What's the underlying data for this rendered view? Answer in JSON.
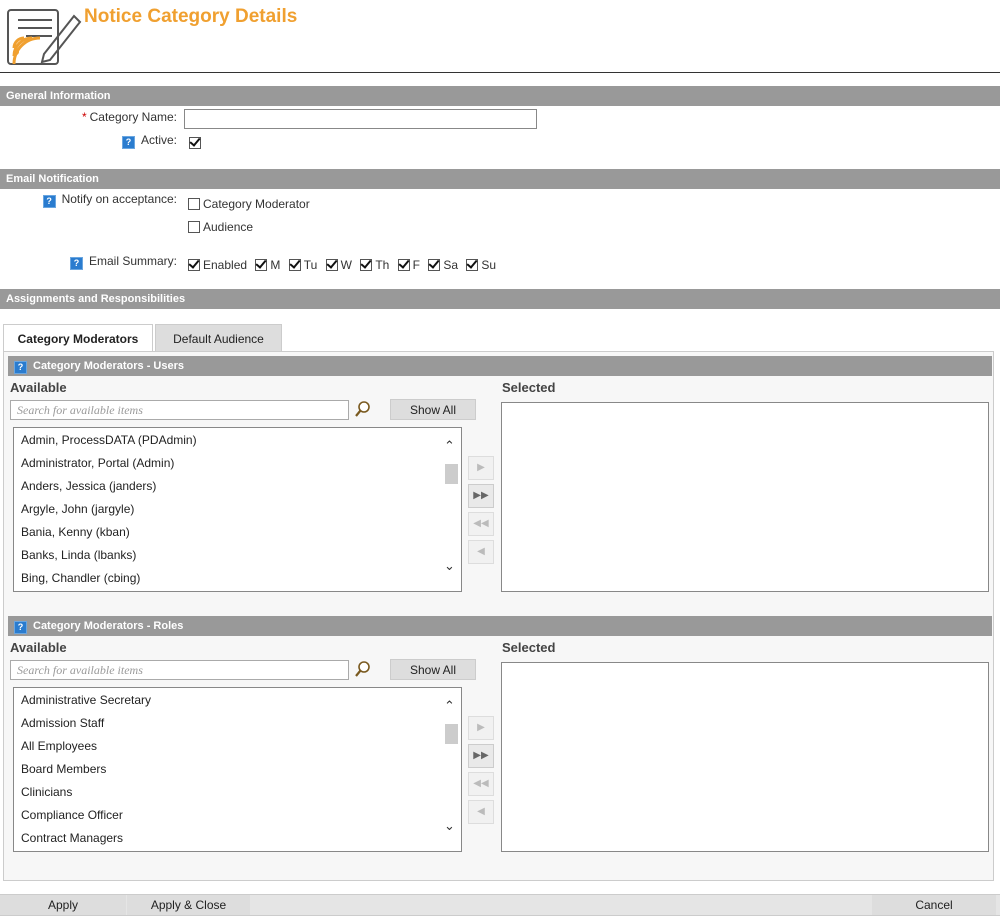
{
  "header": {
    "title": "Notice Category Details"
  },
  "sections": {
    "general": "General Information",
    "email": "Email Notification",
    "assignments": "Assignments and Responsibilities"
  },
  "general": {
    "category_name_label": "Category Name:",
    "category_name_value": "",
    "active_label": "Active:",
    "active_checked": true
  },
  "email": {
    "notify_label": "Notify on acceptance:",
    "notify_options": [
      "Category Moderator",
      "Audience"
    ],
    "summary_label": "Email Summary:",
    "summary_options": [
      "Enabled",
      "M",
      "Tu",
      "W",
      "Th",
      "F",
      "Sa",
      "Su"
    ]
  },
  "tabs": [
    {
      "label": "Category Moderators"
    },
    {
      "label": "Default Audience"
    }
  ],
  "users_panel": {
    "title": "Category Moderators - Users",
    "available_label": "Available",
    "selected_label": "Selected",
    "search_placeholder": "Search for available items",
    "show_all": "Show All",
    "items": [
      "Admin, ProcessDATA (PDAdmin)",
      "Administrator, Portal (Admin)",
      "Anders, Jessica (janders)",
      "Argyle, John (jargyle)",
      "Bania, Kenny (kban)",
      "Banks, Linda (lbanks)",
      "Bing, Chandler (cbing)"
    ]
  },
  "roles_panel": {
    "title": "Category Moderators - Roles",
    "available_label": "Available",
    "selected_label": "Selected",
    "search_placeholder": "Search for available items",
    "show_all": "Show All",
    "items": [
      "Administrative Secretary",
      "Admission Staff",
      "All Employees",
      "Board Members",
      "Clinicians",
      "Compliance Officer",
      "Contract Managers"
    ]
  },
  "footer": {
    "apply": "Apply",
    "apply_close": "Apply & Close",
    "cancel": "Cancel"
  }
}
